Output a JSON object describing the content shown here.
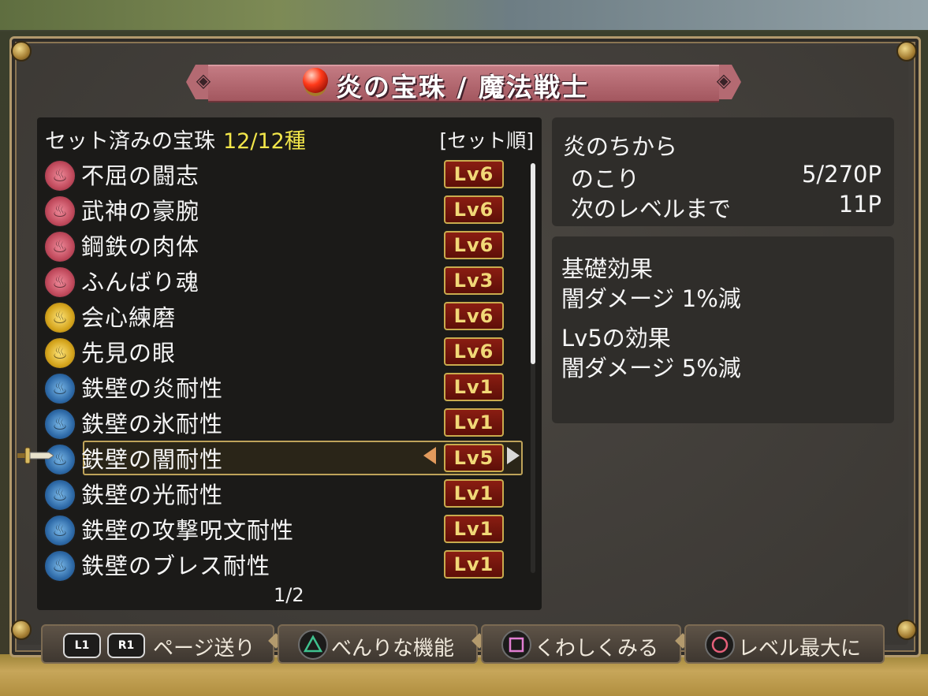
{
  "title": {
    "text": "炎の宝珠 / 魔法戦士",
    "left_glyph": "◈",
    "right_glyph": "◈",
    "orb_icon": "red-orb-icon"
  },
  "list": {
    "header_label": "セット済みの宝珠",
    "header_count": "12/12種",
    "sort_label": "[セット順]",
    "items": [
      {
        "name": "不屈の闘志",
        "level": "Lv6",
        "color": "red"
      },
      {
        "name": "武神の豪腕",
        "level": "Lv6",
        "color": "red"
      },
      {
        "name": "鋼鉄の肉体",
        "level": "Lv6",
        "color": "red"
      },
      {
        "name": "ふんばり魂",
        "level": "Lv3",
        "color": "red"
      },
      {
        "name": "会心練磨",
        "level": "Lv6",
        "color": "yellow"
      },
      {
        "name": "先見の眼",
        "level": "Lv6",
        "color": "yellow"
      },
      {
        "name": "鉄壁の炎耐性",
        "level": "Lv1",
        "color": "blue"
      },
      {
        "name": "鉄壁の氷耐性",
        "level": "Lv1",
        "color": "blue"
      },
      {
        "name": "鉄壁の闇耐性",
        "level": "Lv5",
        "color": "blue",
        "selected": true
      },
      {
        "name": "鉄壁の光耐性",
        "level": "Lv1",
        "color": "blue"
      },
      {
        "name": "鉄壁の攻撃呪文耐性",
        "level": "Lv1",
        "color": "blue"
      },
      {
        "name": "鉄壁のブレス耐性",
        "level": "Lv1",
        "color": "blue"
      }
    ],
    "page": "1/2"
  },
  "power": {
    "title": "炎のちから",
    "remaining_label": "のこり",
    "remaining_value": "5/270P",
    "next_label": "次のレベルまで",
    "next_value": "11P"
  },
  "effects": {
    "base_title": "基礎効果",
    "base_text": "闇ダメージ 1%減",
    "lv_title": "Lv5の効果",
    "lv_text": "闇ダメージ 5%減"
  },
  "buttons": {
    "l1": "L1",
    "r1": "R1",
    "page_turn": "ページ送り",
    "useful": "べんりな機能",
    "details": "くわしくみる",
    "max_level": "レベル最大に"
  },
  "colors": {
    "gem_red": "#c04a5c",
    "gem_yellow": "#d4a41c",
    "gem_blue": "#2e6aa8",
    "accent_gold": "#e2cf7b",
    "count_yellow": "#f2e64a"
  }
}
